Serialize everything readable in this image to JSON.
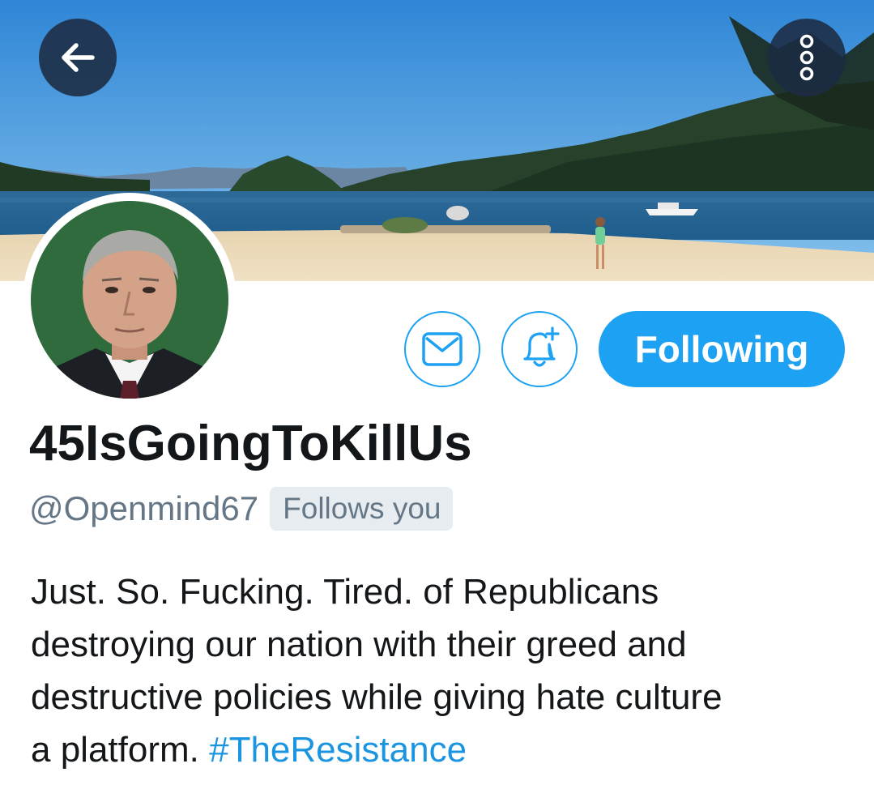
{
  "profile": {
    "display_name": "45IsGoingToKillUs",
    "handle": "@Openmind67",
    "follows_you": "Follows you",
    "bio": {
      "lines": [
        "Just. So. Fucking. Tired. of Republicans",
        "destroying our nation with their greed and",
        "destructive policies while giving hate culture"
      ],
      "last_line_text": "a platform. ",
      "hashtag": "#TheResistance"
    }
  },
  "actions": {
    "following_label": "Following"
  },
  "icons": {
    "back": "back-arrow-icon",
    "more": "more-vertical-icon",
    "message": "envelope-icon",
    "notifications": "bell-plus-icon"
  },
  "colors": {
    "accent": "#1da1f2",
    "hashtag": "#1b95e0",
    "text_primary": "#14171a",
    "text_secondary": "#657786",
    "badge_bg": "#e6ecf0"
  }
}
